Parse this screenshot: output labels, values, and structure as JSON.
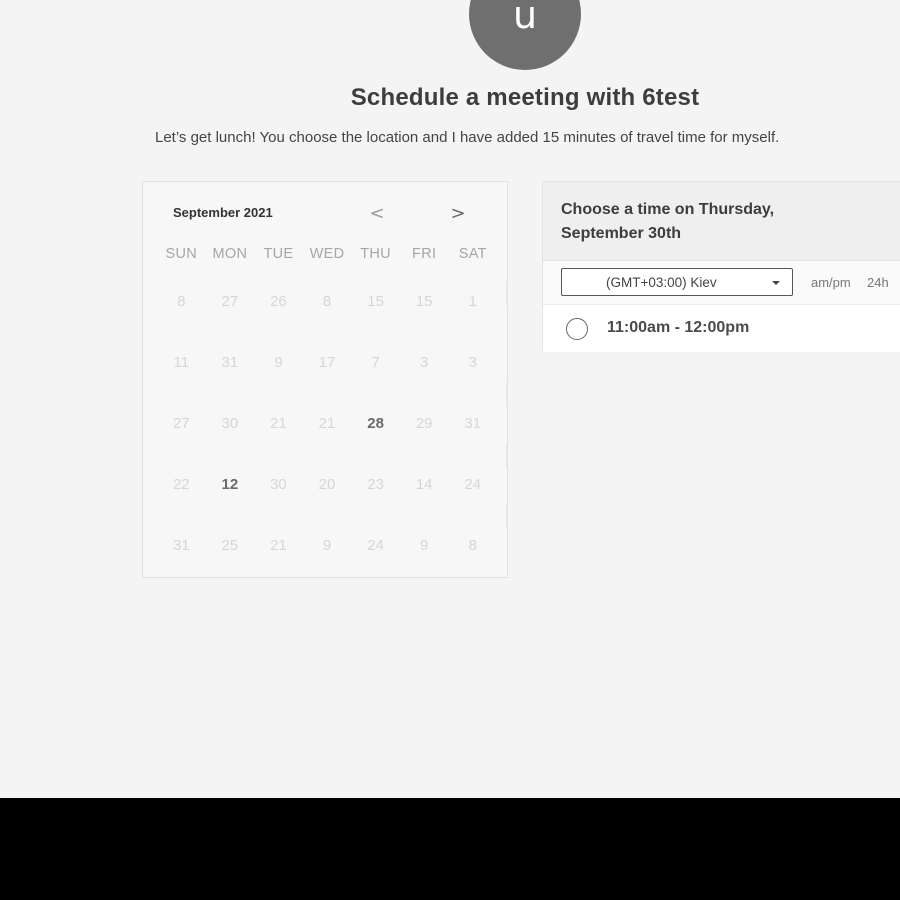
{
  "profile": {
    "avatar_letter": "u",
    "title": "Schedule a meeting with 6test",
    "description": "Let’s get lunch! You choose the location and I have added 15 minutes of travel time for myself."
  },
  "calendar": {
    "month_label": "September 2021",
    "prev_icon": "chevron-left-icon",
    "next_icon": "chevron-right-icon",
    "prev_glyph": "<",
    "next_glyph": ">",
    "weekdays": [
      "SUN",
      "MON",
      "TUE",
      "WED",
      "THU",
      "FRI",
      "SAT"
    ],
    "weeks": [
      [
        {
          "day": "8"
        },
        {
          "day": "27"
        },
        {
          "day": "26"
        },
        {
          "day": "8"
        },
        {
          "day": "15"
        },
        {
          "day": "15"
        },
        {
          "day": "1"
        }
      ],
      [
        {
          "day": "11"
        },
        {
          "day": "31"
        },
        {
          "day": "9"
        },
        {
          "day": "17"
        },
        {
          "day": "7"
        },
        {
          "day": "3"
        },
        {
          "day": "3"
        }
      ],
      [
        {
          "day": "27"
        },
        {
          "day": "30"
        },
        {
          "day": "21"
        },
        {
          "day": "21"
        },
        {
          "day": "28",
          "available": true
        },
        {
          "day": "29"
        },
        {
          "day": "31"
        }
      ],
      [
        {
          "day": "22"
        },
        {
          "day": "12",
          "available": true
        },
        {
          "day": "30"
        },
        {
          "day": "20"
        },
        {
          "day": "23"
        },
        {
          "day": "14"
        },
        {
          "day": "24"
        }
      ],
      [
        {
          "day": "31"
        },
        {
          "day": "25"
        },
        {
          "day": "21"
        },
        {
          "day": "9"
        },
        {
          "day": "24"
        },
        {
          "day": "9"
        },
        {
          "day": "8"
        }
      ]
    ]
  },
  "times": {
    "heading": "Choose a time on Thursday, September 30th",
    "timezone": "(GMT+03:00) Kiev",
    "format_ampm": "am/pm",
    "format_24h": "24h",
    "slots": [
      {
        "label": "11:00am - 12:00pm",
        "selected": false
      }
    ]
  },
  "colors": {
    "page_background": "#f4f4f4",
    "avatar": "#6f6f6f",
    "bottom_bar": "#000000"
  }
}
